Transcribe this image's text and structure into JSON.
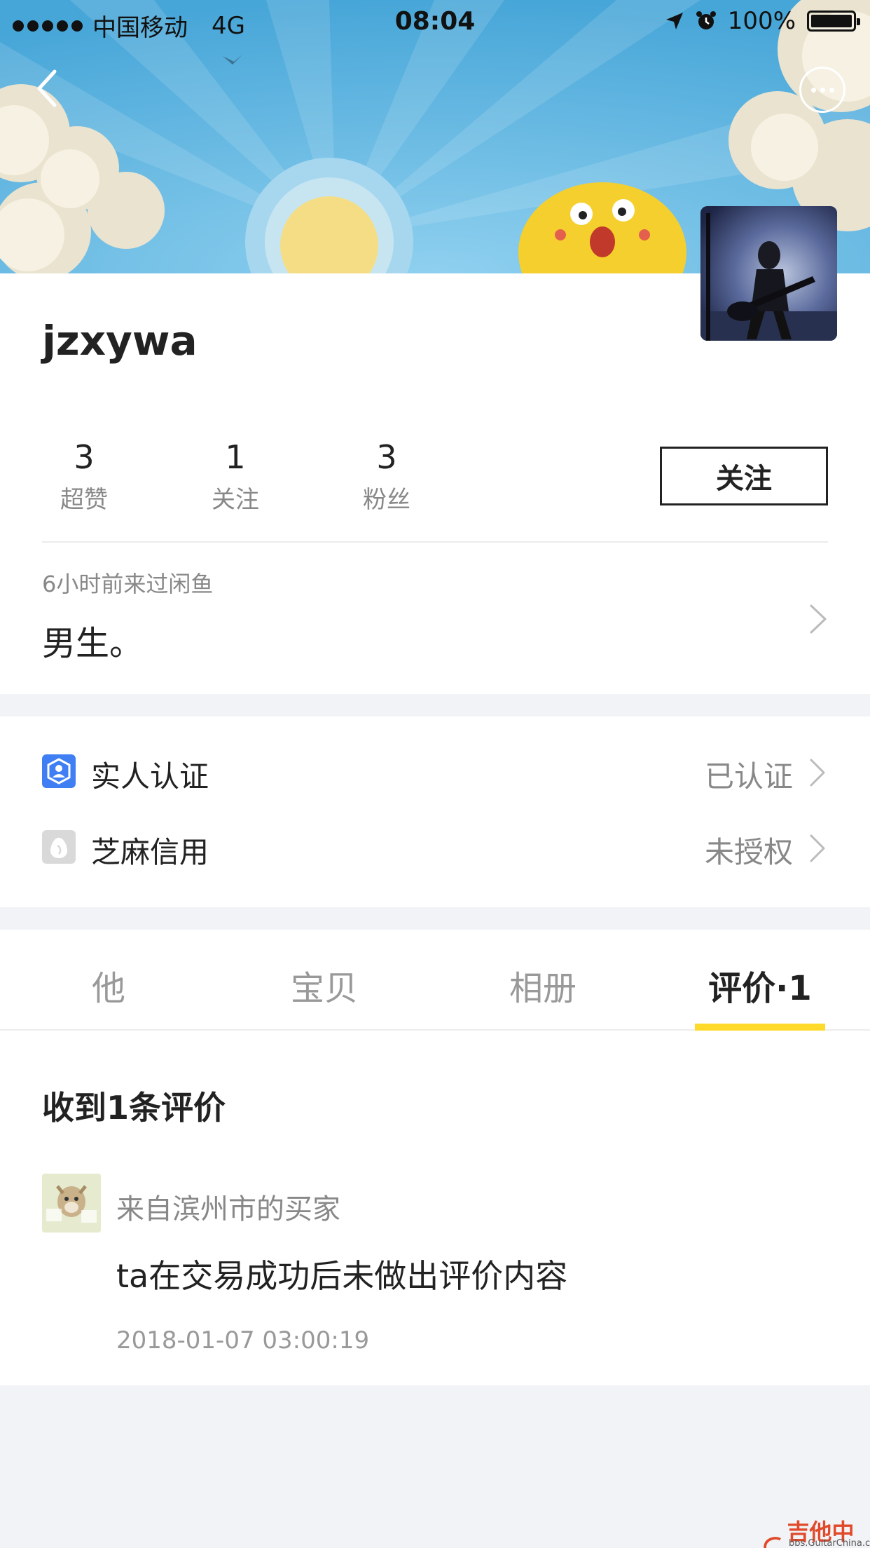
{
  "status_bar": {
    "carrier": "中国移动",
    "network": "4G",
    "time": "08:04",
    "battery": "100%"
  },
  "icons": {
    "back": "chevron-left-icon",
    "more": "more-dots-icon",
    "location": "location-arrow-icon",
    "alarm": "alarm-icon",
    "battery": "battery-icon",
    "real_person": "person-shield-icon",
    "sesame": "sesame-egg-icon",
    "arrow": "chevron-right-icon"
  },
  "colors": {
    "banner_sky": "#5db3df",
    "tab_accent": "#ffda2b",
    "verify_icon": "#3f7ff3",
    "watermark": "#e04a2a"
  },
  "profile": {
    "username": "jzxywa",
    "stats": [
      {
        "value": "3",
        "label": "超赞"
      },
      {
        "value": "1",
        "label": "关注"
      },
      {
        "value": "3",
        "label": "粉丝"
      }
    ],
    "follow_label": "关注",
    "last_visit": "6小时前来过闲鱼",
    "bio": "男生。"
  },
  "verification": {
    "items": [
      {
        "label": "实人认证",
        "status": "已认证"
      },
      {
        "label": "芝麻信用",
        "status": "未授权"
      }
    ]
  },
  "tabs": [
    "他",
    "宝贝",
    "相册",
    "评价·1"
  ],
  "reviews": {
    "title": "收到1条评价",
    "items": [
      {
        "from": "来自滨州市的买家",
        "text": "ta在交易成功后未做出评价内容",
        "date": "2018-01-07 03:00:19"
      }
    ]
  },
  "watermark": {
    "brand": "吉他中国",
    "site": "bbs.GuitarChina.com"
  }
}
